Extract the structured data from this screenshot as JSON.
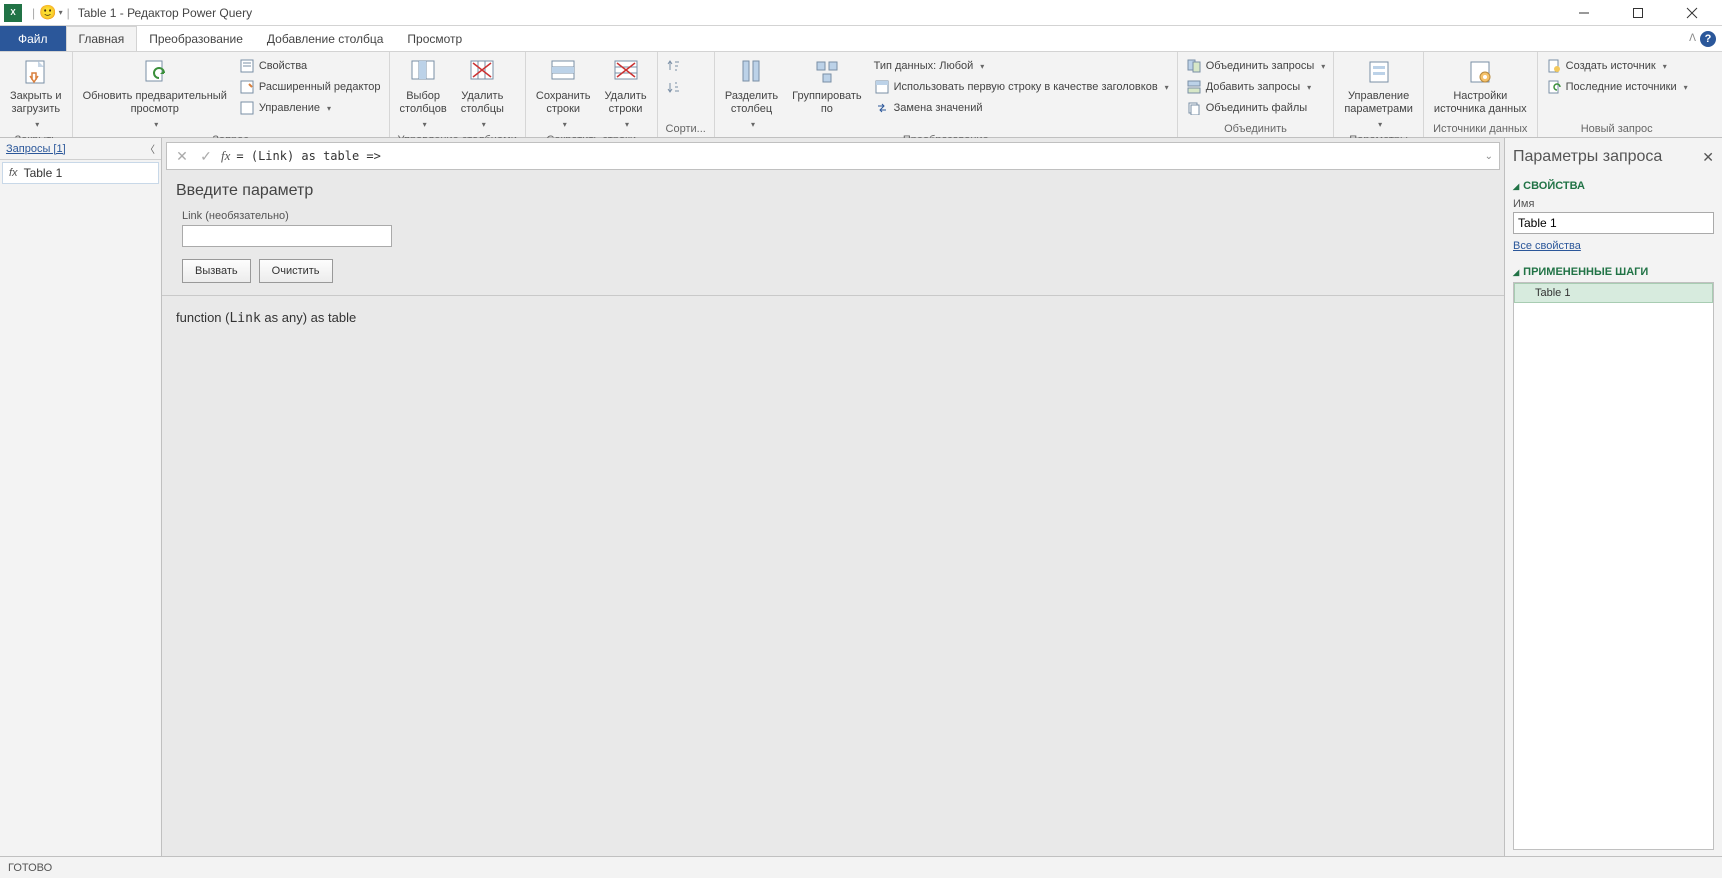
{
  "titlebar": {
    "app_short": "X",
    "title": "Table 1 - Редактор Power Query"
  },
  "tabs": {
    "file": "Файл",
    "home": "Главная",
    "transform": "Преобразование",
    "addcolumn": "Добавление столбца",
    "view": "Просмотр"
  },
  "ribbon": {
    "close_group": {
      "close_load": "Закрыть и\nзагрузить",
      "label": "Закрыть"
    },
    "query_group": {
      "refresh": "Обновить предварительный\nпросмотр",
      "properties": "Свойства",
      "advanced": "Расширенный редактор",
      "manage": "Управление",
      "label": "Запрос"
    },
    "columns_group": {
      "choose": "Выбор\nстолбцов",
      "remove": "Удалить\nстолбцы",
      "label": "Управление столбцами"
    },
    "rows_group": {
      "keep": "Сохранить\nстроки",
      "remove": "Удалить\nстроки",
      "label": "Сократить строки"
    },
    "sort_group": {
      "label": "Сорти..."
    },
    "transform_group": {
      "split": "Разделить\nстолбец",
      "group": "Группировать\nпо",
      "datatype": "Тип данных: Любой",
      "firstrow": "Использовать первую строку в качестве заголовков",
      "replace": "Замена значений",
      "label": "Преобразование"
    },
    "combine_group": {
      "merge": "Объединить запросы",
      "append": "Добавить запросы",
      "files": "Объединить файлы",
      "label": "Объединить"
    },
    "params_group": {
      "manage": "Управление\nпараметрами",
      "label": "Параметры"
    },
    "sources_group": {
      "settings": "Настройки\nисточника данных",
      "label": "Источники данных"
    },
    "new_group": {
      "new_source": "Создать источник",
      "recent": "Последние источники",
      "label": "Новый запрос"
    }
  },
  "queries_panel": {
    "title": "Запросы [1]",
    "item": "Table 1"
  },
  "formula": "= (Link) as table =>",
  "param_area": {
    "heading": "Введите параметр",
    "field_label": "Link (необязательно)",
    "invoke": "Вызвать",
    "clear": "Очистить"
  },
  "func_sig": {
    "pre": "function (",
    "arg": "Link",
    "post": " as any) as table"
  },
  "right_panel": {
    "heading": "Параметры запроса",
    "props_title": "СВОЙСТВА",
    "name_label": "Имя",
    "name_value": "Table 1",
    "all_props": "Все свойства",
    "steps_title": "ПРИМЕНЕННЫЕ ШАГИ",
    "step1": "Table 1"
  },
  "status": "ГОТОВО"
}
